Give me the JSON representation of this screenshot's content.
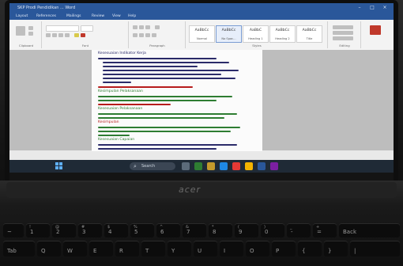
{
  "window": {
    "title": "SKP Prodi Pendidikan ... Word",
    "controls": [
      "–",
      "□",
      "×"
    ]
  },
  "ribbon": {
    "tabs": [
      "Layout",
      "References",
      "Mailings",
      "Review",
      "View",
      "Help"
    ],
    "groups": [
      "Clipboard",
      "Font",
      "Paragraph",
      "Styles",
      "Editing"
    ],
    "styles": [
      {
        "preview": "AaBbCc",
        "caption": "Normal"
      },
      {
        "preview": "AaBbCc",
        "caption": "No Spac..."
      },
      {
        "preview": "AaBbC",
        "caption": "Heading 1"
      },
      {
        "preview": "AaBbCc",
        "caption": "Heading 2"
      },
      {
        "preview": "AaBbCc",
        "caption": "Title"
      }
    ]
  },
  "document": {
    "heading": "Kesesuaian Indikator Kerja",
    "green_labels": [
      "Kesimpulan Pelaksanaan",
      "Kesesuaian Pelaksanaan",
      "Kesimpulan",
      "Kesesuaian Capaian"
    ]
  },
  "taskbar": {
    "search_label": "Search"
  },
  "laptop": {
    "brand": "acer"
  },
  "keyboard": {
    "row1": [
      {
        "top": "",
        "bottom": "~"
      },
      {
        "top": "!",
        "bottom": "1"
      },
      {
        "top": "@",
        "bottom": "2"
      },
      {
        "top": "#",
        "bottom": "3"
      },
      {
        "top": "$",
        "bottom": "4"
      },
      {
        "top": "%",
        "bottom": "5"
      },
      {
        "top": "^",
        "bottom": "6"
      },
      {
        "top": "&",
        "bottom": "7"
      },
      {
        "top": "*",
        "bottom": "8"
      },
      {
        "top": "(",
        "bottom": "9"
      },
      {
        "top": ")",
        "bottom": "0"
      },
      {
        "top": "_",
        "bottom": "-"
      },
      {
        "top": "+",
        "bottom": "="
      },
      {
        "top": "",
        "bottom": "Back"
      }
    ],
    "row2": [
      {
        "top": "",
        "bottom": "Tab"
      },
      {
        "top": "",
        "bottom": "Q"
      },
      {
        "top": "",
        "bottom": "W"
      },
      {
        "top": "",
        "bottom": "E"
      },
      {
        "top": "",
        "bottom": "R"
      },
      {
        "top": "",
        "bottom": "T"
      },
      {
        "top": "",
        "bottom": "Y"
      },
      {
        "top": "",
        "bottom": "U"
      },
      {
        "top": "",
        "bottom": "I"
      },
      {
        "top": "",
        "bottom": "O"
      },
      {
        "top": "",
        "bottom": "P"
      },
      {
        "top": "",
        "bottom": "{"
      },
      {
        "top": "",
        "bottom": "}"
      },
      {
        "top": "",
        "bottom": "|"
      }
    ]
  },
  "colors": {
    "word_blue": "#2a579a",
    "doc_text": "#2b2b6a",
    "doc_green": "#2e7d32",
    "doc_red": "#b71c1c",
    "taskbar": "#1f2a36"
  }
}
